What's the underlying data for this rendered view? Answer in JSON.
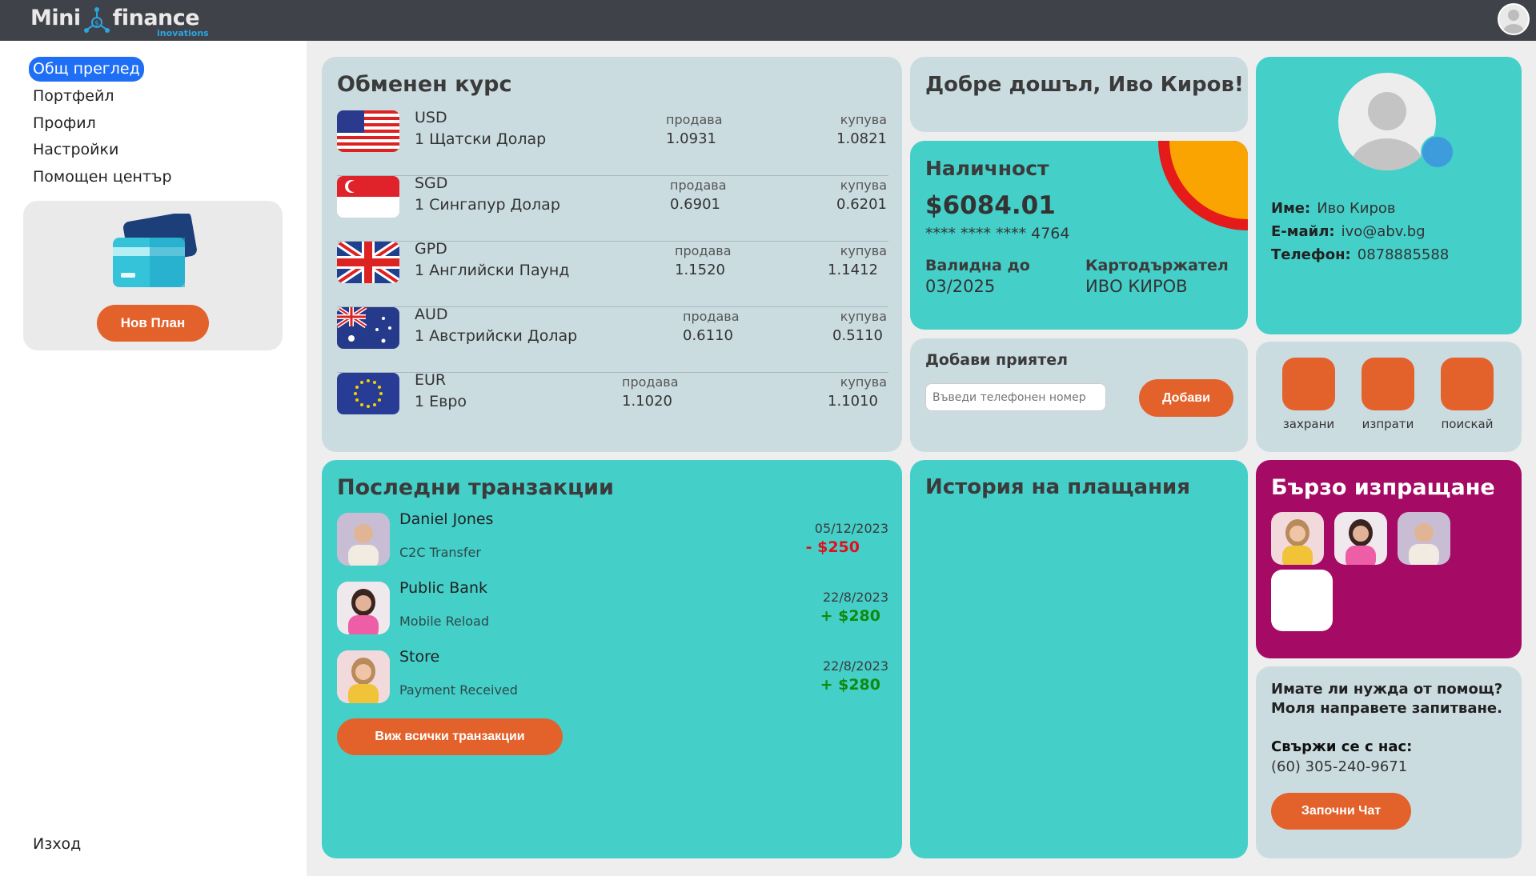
{
  "app": {
    "logo_left": "Mini",
    "logo_right": "finance",
    "logo_tagline": "inovations"
  },
  "nav": {
    "items": [
      "Общ преглед",
      "Портфейл",
      "Профил",
      "Настройки",
      "Помощен център"
    ],
    "logout": "Изход"
  },
  "plan": {
    "button": "Нов План"
  },
  "exchange": {
    "title": "Обменен курс",
    "sell_label": "продава",
    "buy_label": "купува",
    "rates": [
      {
        "code": "USD",
        "name": "1 Щатски Долар",
        "sell": "1.0931",
        "buy": "1.0821",
        "flag": "us-flag"
      },
      {
        "code": "SGD",
        "name": "1 Сингапур Долар",
        "sell": "0.6901",
        "buy": "0.6201",
        "flag": "sg-flag"
      },
      {
        "code": "GPD",
        "name": "1 Английски Паунд",
        "sell": "1.1520",
        "buy": "1.1412",
        "flag": "gb-flag"
      },
      {
        "code": "AUD",
        "name": "1 Австрийски Долар",
        "sell": "0.6110",
        "buy": "0.5110",
        "flag": "au-flag"
      },
      {
        "code": "EUR",
        "name": "1 Евро",
        "sell": "1.1020",
        "buy": "1.1010",
        "flag": "eu-flag"
      }
    ]
  },
  "welcome": {
    "text": "Добре дошъл, Иво Киров!"
  },
  "balance": {
    "title": "Наличност",
    "amount": "$6084.01",
    "card_number": "****  ****  ****  4764",
    "valid_label": "Валидна до",
    "valid_value": "03/2025",
    "holder_label": "Картодържател",
    "holder_value": "ИВО КИРОВ"
  },
  "profile": {
    "name_label": "Име:",
    "name_value": "Иво Киров",
    "email_label": "Е-майл:",
    "email_value": "ivo@abv.bg",
    "phone_label": "Телефон:",
    "phone_value": "0878885588"
  },
  "add_friend": {
    "title": "Добави приятел",
    "placeholder": "Въведи телефонен номер",
    "button": "Добави"
  },
  "quick_actions": [
    "захрани",
    "изпрати",
    "поискай"
  ],
  "transactions": {
    "title": "Последни транзакции",
    "items": [
      {
        "name": "Daniel Jones",
        "type": "C2C Transfer",
        "date": "05/12/2023",
        "amount": "-  $250"
      },
      {
        "name": "Public Bank",
        "type": "Mobile Reload",
        "date": "22/8/2023",
        "amount": "+ $280"
      },
      {
        "name": "Store",
        "type": "Payment Received",
        "date": "22/8/2023",
        "amount": "+ $280"
      }
    ],
    "button": "Виж всички транзакции"
  },
  "history": {
    "title": "История на плащания"
  },
  "quick_send": {
    "title": "Бързо изпращане"
  },
  "help": {
    "text": "Имате ли нужда от помощ? Моля направете запитване.",
    "contact_label": "Свържи се с нас:",
    "phone": "(60) 305-240-9671",
    "button": "Започни Чат"
  },
  "colors": {
    "topbar": "#404249",
    "accent_orange": "#e3622b",
    "teal": "#44cfc9",
    "gray_card": "#cbdce1",
    "magenta": "#a50a65",
    "active_nav": "#1e6ff5",
    "negative": "#e0111a",
    "positive": "#118a11"
  }
}
